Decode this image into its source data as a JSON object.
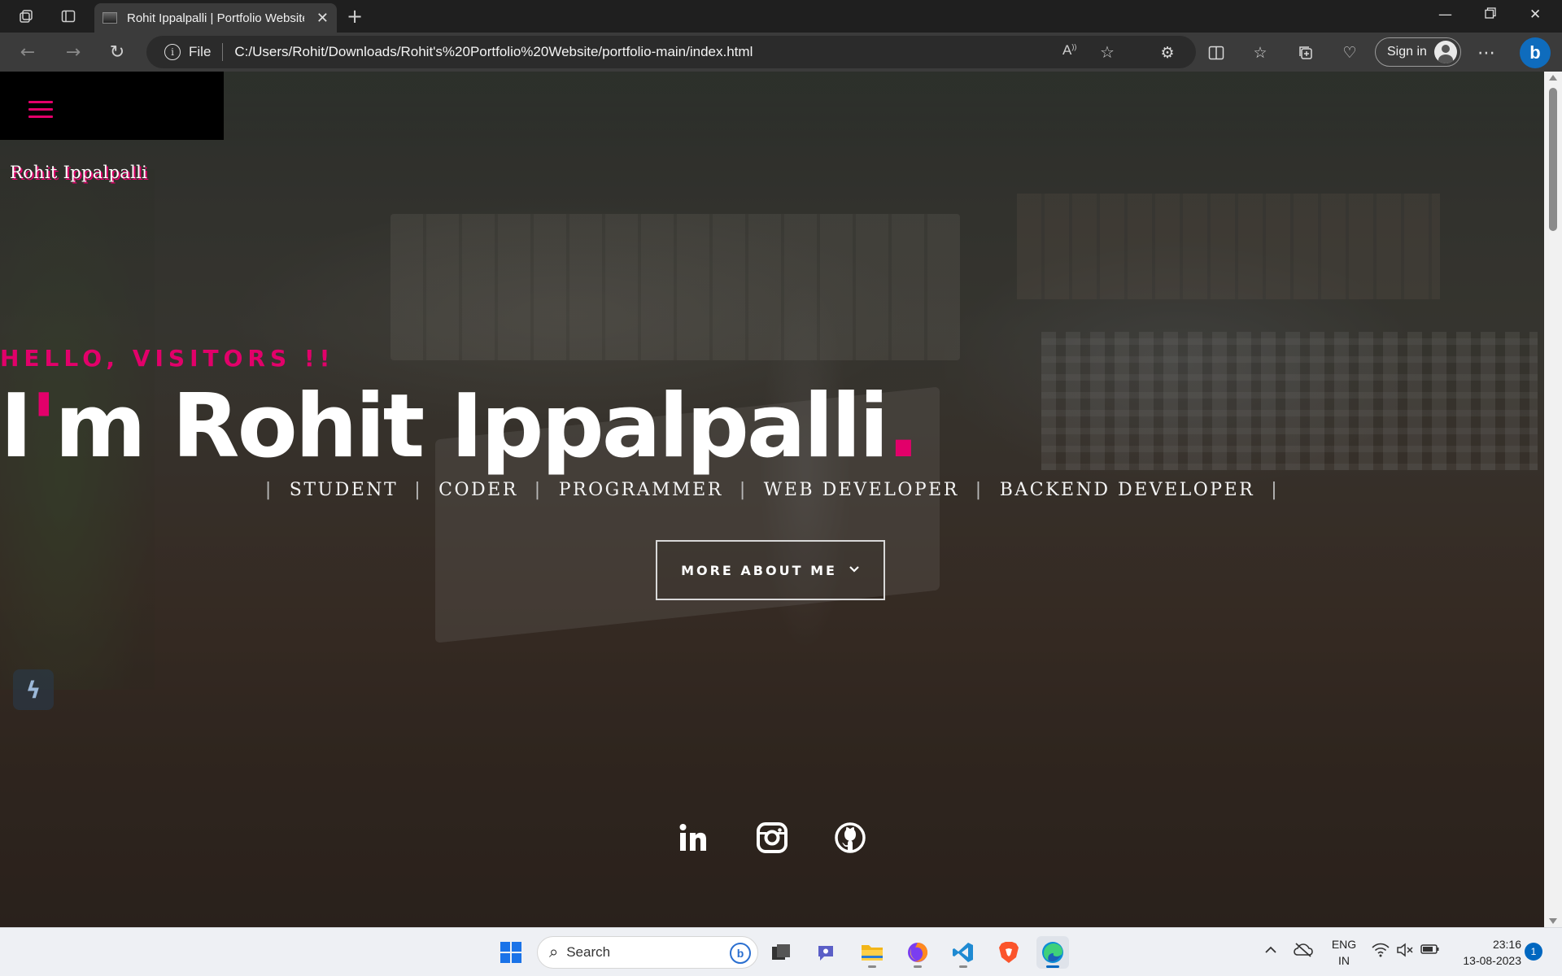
{
  "browser": {
    "tab": {
      "title": "Rohit Ippalpalli | Portfolio Website"
    },
    "address": {
      "scheme_label": "File",
      "url": "C:/Users/Rohit/Downloads/Rohit's%20Portfolio%20Website/portfolio-main/index.html"
    },
    "signin_label": "Sign in"
  },
  "page": {
    "site_name": "Rohit Ippalpalli",
    "greeting": "HELLO, VISITORS !!",
    "hero": {
      "prefix": "I",
      "apostrophe": "'",
      "rest": "m Rohit Ippalpalli",
      "dot": "."
    },
    "roles": [
      "STUDENT",
      "CODER",
      "PROGRAMMER",
      "WEB DEVELOPER",
      "BACKEND DEVELOPER"
    ],
    "more_button": "MORE ABOUT ME",
    "socials": [
      "linkedin-icon",
      "instagram-icon",
      "github-icon"
    ],
    "accent_color": "#e2006a"
  },
  "taskbar": {
    "search_placeholder": "Search",
    "language": {
      "line1": "ENG",
      "line2": "IN"
    },
    "clock": {
      "time": "23:16",
      "date": "13-08-2023"
    },
    "notification_count": "1"
  }
}
